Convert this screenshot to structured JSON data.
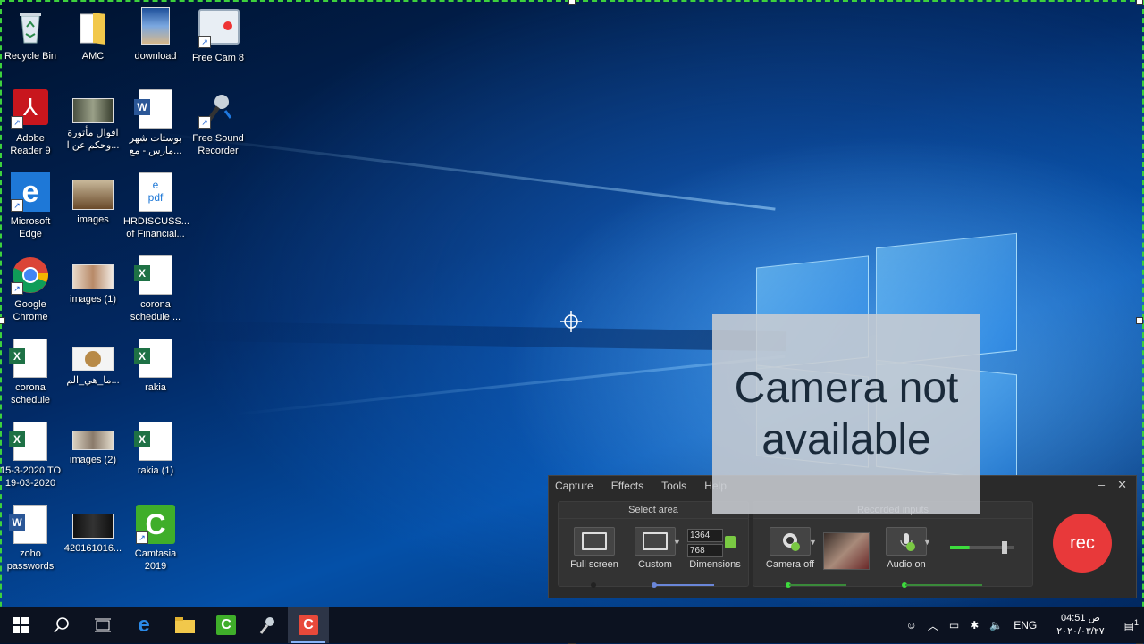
{
  "desktop_icons": [
    {
      "label": "Recycle Bin",
      "icon": "recycle-bin-icon"
    },
    {
      "label": "AMC",
      "icon": "folder-icon"
    },
    {
      "label": "download",
      "icon": "image-file-icon"
    },
    {
      "label": "Free Cam 8",
      "icon": "free-cam-icon"
    },
    {
      "label": "Adobe\nReader 9",
      "icon": "adobe-reader-icon"
    },
    {
      "label": "اقوال مأثورة\nوحكم عن ا...",
      "icon": "image-file-icon"
    },
    {
      "label": "بوستات شهر\nمارس - مع...",
      "icon": "word-doc-icon"
    },
    {
      "label": "Free Sound\nRecorder",
      "icon": "microphone-icon"
    },
    {
      "label": "Microsoft\nEdge",
      "icon": "edge-icon"
    },
    {
      "label": "images",
      "icon": "image-file-icon"
    },
    {
      "label": "HRDISCUSS...\nof Financial...",
      "icon": "pdf-file-icon"
    },
    {
      "label": "Google\nChrome",
      "icon": "chrome-icon"
    },
    {
      "label": "images (1)",
      "icon": "image-file-icon"
    },
    {
      "label": "corona\nschedule ...",
      "icon": "excel-file-icon"
    },
    {
      "label": "corona\nschedule",
      "icon": "excel-file-icon"
    },
    {
      "label": "ما_هي_الم...",
      "icon": "image-file-icon"
    },
    {
      "label": "rakia",
      "icon": "excel-file-icon"
    },
    {
      "label": "15-3-2020 TO\n19-03-2020",
      "icon": "excel-file-icon"
    },
    {
      "label": "images (2)",
      "icon": "image-file-icon"
    },
    {
      "label": "rakia (1)",
      "icon": "excel-file-icon"
    },
    {
      "label": "zoho\npasswords",
      "icon": "word-doc-icon"
    },
    {
      "label": "420161016...",
      "icon": "image-file-icon"
    },
    {
      "label": "Camtasia\n2019",
      "icon": "camtasia-icon"
    }
  ],
  "camera_overlay": {
    "text": "Camera not available"
  },
  "recorder": {
    "menu": [
      "Capture",
      "Effects",
      "Tools",
      "Help"
    ],
    "select_area": {
      "title": "Select area",
      "full_screen": "Full screen",
      "custom": "Custom",
      "dimensions": "Dimensions",
      "width": "1364",
      "height": "768"
    },
    "recorded_inputs": {
      "title": "Recorded inputs",
      "camera": "Camera off",
      "audio": "Audio on",
      "audio_level": 0.3
    },
    "rec_label": "rec"
  },
  "taskbar": {
    "apps": [
      "start-icon",
      "search-icon",
      "task-view-icon",
      "edge-icon",
      "file-explorer-icon",
      "camtasia-icon",
      "free-sound-recorder-icon",
      "camtasia-recorder-icon"
    ],
    "language": "ENG",
    "time": "04:51 ص",
    "date": "٢٠٢٠/٠٣/٢٧",
    "notification_count": "1"
  }
}
